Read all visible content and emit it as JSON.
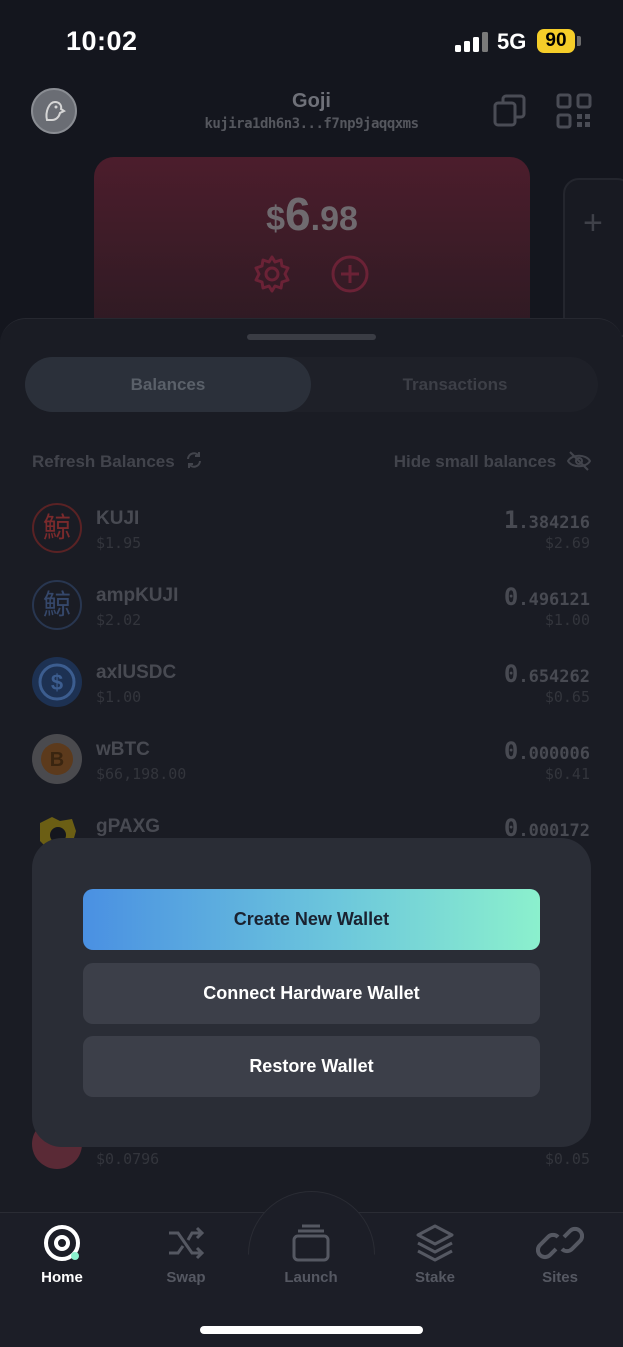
{
  "status_bar": {
    "time": "10:02",
    "network": "5G",
    "battery": "90"
  },
  "header": {
    "wallet_name": "Goji",
    "address": "kujira1dh6n3...f7np9jaqqxms"
  },
  "balance_card": {
    "currency": "$",
    "whole": "6",
    "cents": ".98"
  },
  "tabs": {
    "balances": "Balances",
    "transactions": "Transactions"
  },
  "controls": {
    "refresh": "Refresh Balances",
    "hide_small": "Hide small balances"
  },
  "assets": [
    {
      "symbol": "KUJI",
      "price": "$1.95",
      "amount_int": "1",
      "amount_dec": ".384216",
      "value": "$2.69",
      "color": "#c0392b"
    },
    {
      "symbol": "ampKUJI",
      "price": "$2.02",
      "amount_int": "0",
      "amount_dec": ".496121",
      "value": "$1.00",
      "color": "#2f4a7a"
    },
    {
      "symbol": "axlUSDC",
      "price": "$1.00",
      "amount_int": "0",
      "amount_dec": ".654262",
      "value": "$0.65",
      "color": "#2775ca"
    },
    {
      "symbol": "wBTC",
      "price": "$66,198.00",
      "amount_int": "0",
      "amount_dec": ".000006",
      "value": "$0.41",
      "color": "#f7931a"
    },
    {
      "symbol": "gPAXG",
      "price": "",
      "amount_int": "0",
      "amount_dec": ".000172",
      "value": "",
      "color": "#e6c619"
    }
  ],
  "partial_row": {
    "price": "$0.0796",
    "value": "$0.05"
  },
  "modal": {
    "create": "Create New Wallet",
    "hardware": "Connect Hardware Wallet",
    "restore": "Restore Wallet"
  },
  "tabbar": {
    "home": "Home",
    "swap": "Swap",
    "launch": "Launch",
    "stake": "Stake",
    "sites": "Sites"
  }
}
